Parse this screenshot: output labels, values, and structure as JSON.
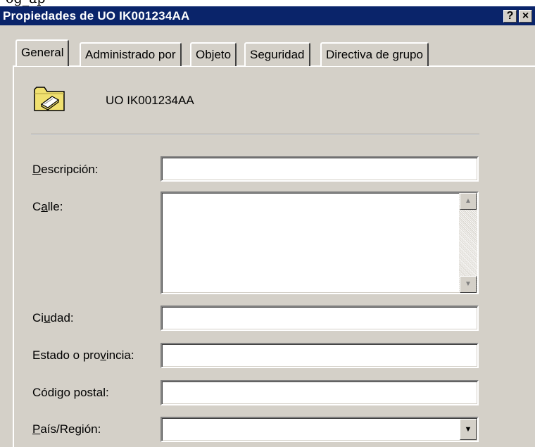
{
  "caption_fragment": "og_ap",
  "window": {
    "title": "Propiedades de UO IK001234AA",
    "help_label": "?",
    "close_label": "×"
  },
  "tabs": [
    {
      "label": "General",
      "active": true
    },
    {
      "label": "Administrado por",
      "active": false
    },
    {
      "label": "Objeto",
      "active": false
    },
    {
      "label": "Seguridad",
      "active": false
    },
    {
      "label": "Directiva de grupo",
      "active": false
    }
  ],
  "header": {
    "icon": "folder-book-icon",
    "ou_name": "UO IK001234AA"
  },
  "fields": {
    "descripcion": {
      "label": "Descripción:",
      "mnemonic": "D",
      "value": ""
    },
    "calle": {
      "label": "Calle:",
      "mnemonic": "a",
      "value": ""
    },
    "ciudad": {
      "label": "Ciudad:",
      "mnemonic": "u",
      "value": ""
    },
    "estado": {
      "label": "Estado o provincia:",
      "mnemonic": "v",
      "value": ""
    },
    "codigo_postal": {
      "label": "Código postal:",
      "mnemonic": "g",
      "value": ""
    },
    "pais": {
      "label": "País/Región:",
      "mnemonic": "P",
      "value": ""
    }
  },
  "glyphs": {
    "scroll_up": "▲",
    "scroll_down": "▼",
    "dropdown": "▼"
  },
  "colors": {
    "titlebar": "#0a246a",
    "face": "#d4d0c8",
    "folder": "#f0e070"
  }
}
